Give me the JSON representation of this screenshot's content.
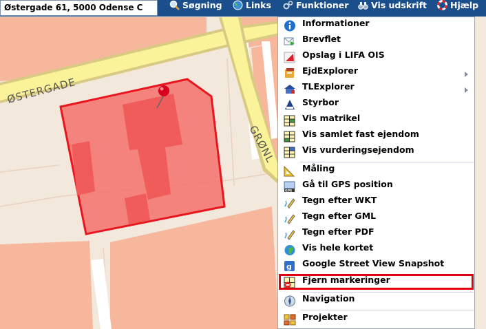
{
  "address": {
    "text": "Østergade 61, 5000 Odense C"
  },
  "toolbar": {
    "search_label": "Søgning",
    "links_label": "Links",
    "functions_label": "Funktioner",
    "print_label": "Vis udskrift",
    "help_label": "Hjælp"
  },
  "map": {
    "street_label_1": "ØSTERGADE",
    "street_label_2": "GRØNL",
    "colors": {
      "background": "#f3e8dc",
      "building": "#f7b79d",
      "road": "#fbf39a",
      "parcel_fill": "#f5716c",
      "parcel_border": "#e8161e"
    }
  },
  "menu": {
    "items": [
      {
        "label": "Informationer",
        "icon": "info-icon"
      },
      {
        "label": "Brevflet",
        "icon": "mail-merge-icon"
      },
      {
        "label": "Opslag i LIFA OIS",
        "icon": "ois-icon"
      },
      {
        "label": "EjdExplorer",
        "icon": "explorer-icon",
        "submenu": true
      },
      {
        "label": "TLExplorer",
        "icon": "tl-explorer-icon",
        "submenu": true
      },
      {
        "label": "Styrbor",
        "icon": "styrbor-icon"
      },
      {
        "label": "Vis matrikel",
        "icon": "grid-icon"
      },
      {
        "label": "Vis samlet fast ejendom",
        "icon": "grid-icon"
      },
      {
        "label": "Vis vurderingsejendom",
        "icon": "grid-icon"
      },
      {
        "label": "Måling",
        "icon": "ruler-icon"
      },
      {
        "label": "Gå til GPS position",
        "icon": "gps-icon"
      },
      {
        "label": "Tegn efter WKT",
        "icon": "pencil-icon"
      },
      {
        "label": "Tegn efter GML",
        "icon": "pencil-icon"
      },
      {
        "label": "Tegn efter PDF",
        "icon": "pencil-icon"
      },
      {
        "label": "Vis hele kortet",
        "icon": "globe-icon"
      },
      {
        "label": "Google Street View Snapshot",
        "icon": "street-view-icon"
      },
      {
        "label": "Fjern markeringer",
        "icon": "remove-markers-icon",
        "highlighted": true
      },
      {
        "label": "Navigation",
        "icon": "compass-icon"
      },
      {
        "label": "Projekter",
        "icon": "projects-icon"
      }
    ],
    "highlight_color": "#e0000f"
  }
}
